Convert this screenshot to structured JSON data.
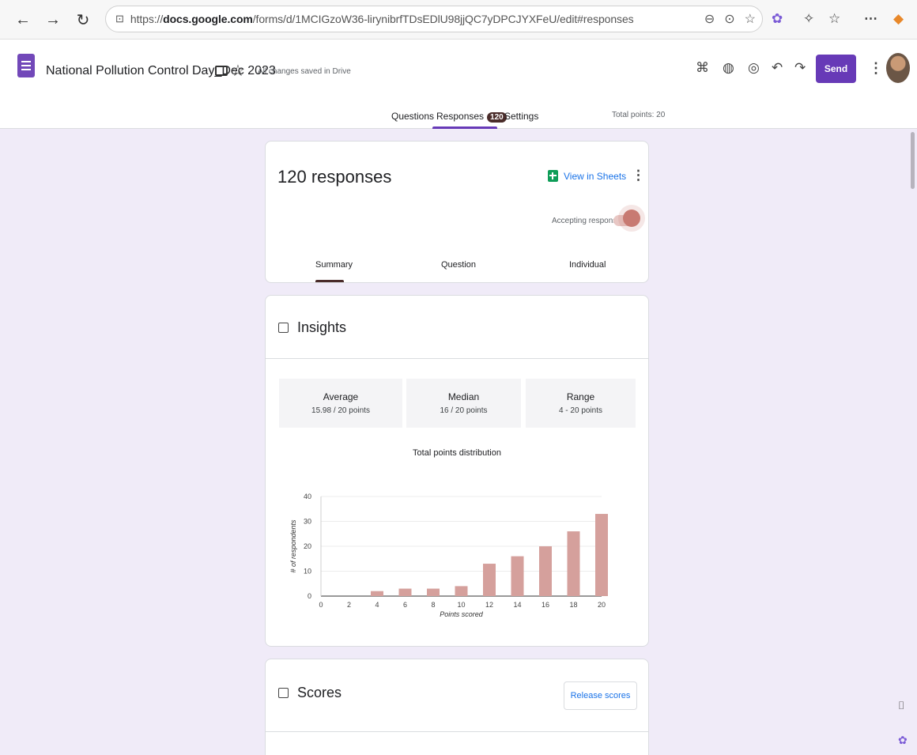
{
  "browser": {
    "url_prefix": "https://",
    "url_domain": "docs.google.com",
    "url_path": "/forms/d/1MCIGzoW36-lirynibrfTDsEDlU98jjQC7yDPCJYXFeU/edit#responses"
  },
  "header": {
    "form_title": "National Pollution Control Day_Dec 2023",
    "saved_status": "All changes saved in Drive",
    "send_label": "Send"
  },
  "tabs": {
    "questions": "Questions",
    "responses": "Responses",
    "responses_count": "120",
    "settings": "Settings",
    "total_points": "Total points: 20"
  },
  "responses_card": {
    "title": "120 responses",
    "view_in_sheets": "View in Sheets",
    "accepting_label": "Accepting responses",
    "accepting": true,
    "subtabs": [
      "Summary",
      "Question",
      "Individual"
    ],
    "active_subtab": "Summary"
  },
  "insights": {
    "title": "Insights",
    "stats": [
      {
        "label": "Average",
        "value": "15.98 / 20 points"
      },
      {
        "label": "Median",
        "value": "16 / 20 points"
      },
      {
        "label": "Range",
        "value": "4 - 20 points"
      }
    ]
  },
  "chart_data": {
    "type": "bar",
    "title": "Total points distribution",
    "xlabel": "Points scored",
    "ylabel": "# of respondents",
    "x_ticks": [
      "0",
      "2",
      "4",
      "6",
      "8",
      "10",
      "12",
      "14",
      "16",
      "18",
      "20"
    ],
    "y_ticks": [
      "0",
      "10",
      "20",
      "30",
      "40"
    ],
    "ylim": [
      0,
      40
    ],
    "categories": [
      4,
      6,
      8,
      10,
      12,
      14,
      16,
      18,
      20
    ],
    "values": [
      2,
      3,
      3,
      4,
      13,
      16,
      20,
      26,
      33
    ],
    "bar_color": "#d5a09c",
    "grid": true
  },
  "scores": {
    "title": "Scores",
    "release_label": "Release scores"
  },
  "colors": {
    "accent": "#673ab7",
    "link": "#1a73e8",
    "background": "#f0ebf8"
  }
}
